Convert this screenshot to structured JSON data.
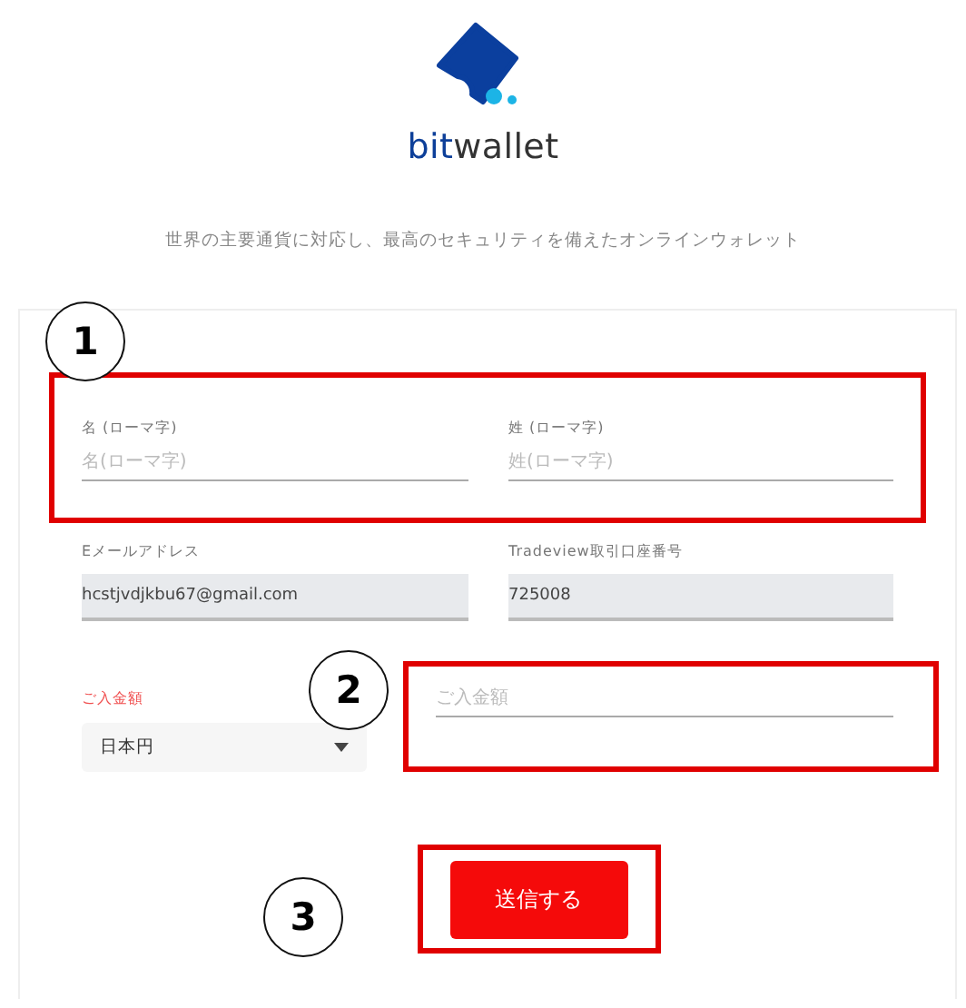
{
  "logo": {
    "prefix": "bit",
    "suffix": "wallet"
  },
  "tagline": "世界の主要通貨に対応し、最高のセキュリティを備えたオンラインウォレット",
  "form": {
    "name_fields": [
      {
        "label": "名 (ローマ字)",
        "placeholder": "名(ローマ字)"
      },
      {
        "label": "姓 (ローマ字)",
        "placeholder": "姓(ローマ字)"
      }
    ],
    "account_fields": [
      {
        "label": "Eメールアドレス",
        "value": "hcstjvdjkbu67@gmail.com",
        "readonly": true
      },
      {
        "label": "Tradeview取引口座番号",
        "value": "725008",
        "readonly": true
      }
    ],
    "currency": {
      "label": "ご入金額",
      "value": "日本円"
    },
    "amount": {
      "placeholder": "ご入金額"
    },
    "submit": "送信する"
  },
  "markers": [
    "1",
    "2",
    "3"
  ]
}
